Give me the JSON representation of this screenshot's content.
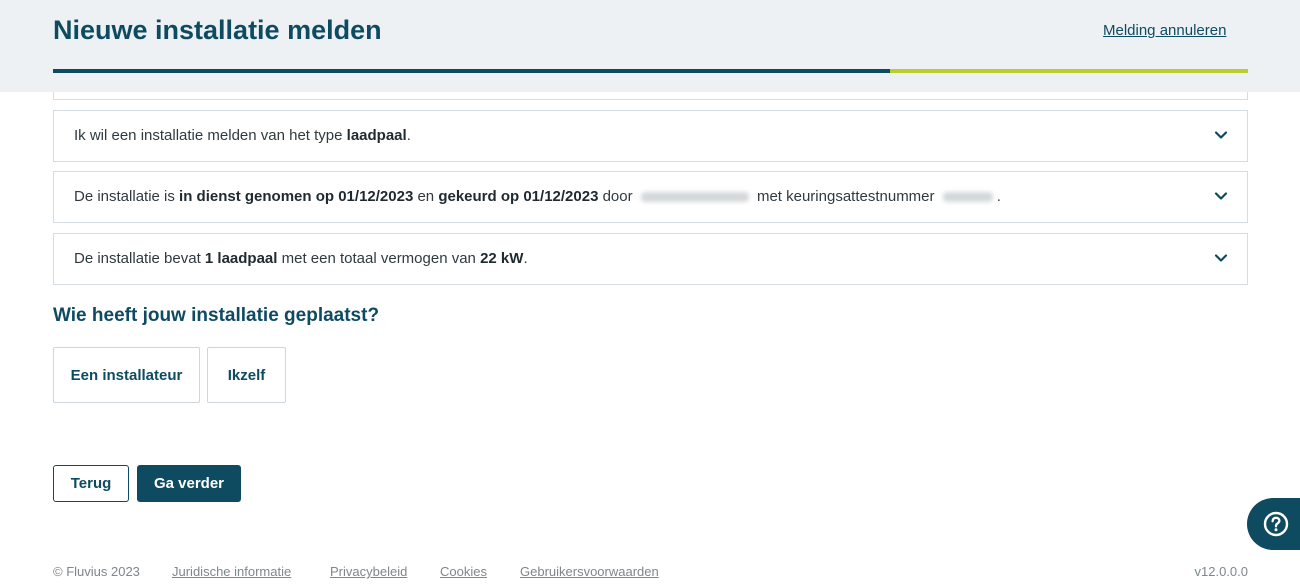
{
  "header": {
    "title": "Nieuwe installatie melden",
    "cancel_label": "Melding annuleren",
    "progress_fraction": 0.7
  },
  "summary": [
    {
      "parts": [
        "Ik wil een installatie melden van het type ",
        "laadpaal",
        "."
      ]
    },
    {
      "parts": [
        "De installatie is ",
        "in dienst genomen op 01/12/2023",
        " en ",
        "gekeurd op 01/12/2023",
        " door ",
        " met keuringsattestnummer ",
        "."
      ]
    },
    {
      "parts": [
        "De installatie bevat ",
        "1 laadpaal",
        " met een totaal vermogen van ",
        "22 kW",
        "."
      ]
    }
  ],
  "question": {
    "label": "Wie heeft jouw installatie geplaatst?",
    "options": [
      "Een installateur",
      "Ikzelf"
    ]
  },
  "actions": {
    "back_label": "Terug",
    "next_label": "Ga verder"
  },
  "footer": {
    "copyright": "© Fluvius 2023",
    "links": [
      "Juridische informatie",
      "Privacybeleid",
      "Cookies",
      "Gebruikersvoorwaarden"
    ],
    "version": "v12.0.0.0"
  },
  "icons": {
    "chevron": "chevron-down-icon",
    "help": "question-circle-icon"
  },
  "colors": {
    "primary": "#0e4b61",
    "accent": "#b9cd2c",
    "header_bg": "#edf1f4"
  }
}
